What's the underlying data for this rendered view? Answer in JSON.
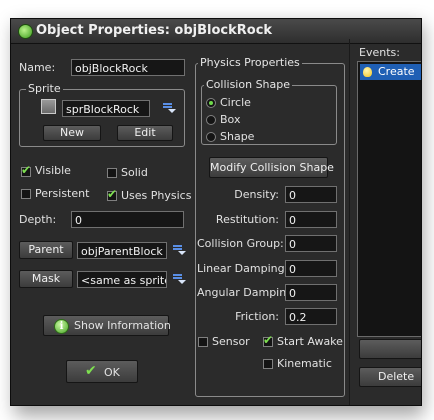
{
  "window": {
    "title": "Object Properties: objBlockRock"
  },
  "name": {
    "label": "Name:",
    "value": "objBlockRock"
  },
  "sprite": {
    "group_label": "Sprite",
    "value": "sprBlockRock",
    "new_label": "New",
    "edit_label": "Edit"
  },
  "checkboxes": {
    "visible": {
      "label": "Visible",
      "checked": true
    },
    "solid": {
      "label": "Solid",
      "checked": false
    },
    "persistent": {
      "label": "Persistent",
      "checked": false
    },
    "uses_physics": {
      "label": "Uses Physics",
      "checked": true
    }
  },
  "depth": {
    "label": "Depth:",
    "value": "0"
  },
  "parent": {
    "label": "Parent",
    "value": "objParentBlock"
  },
  "mask": {
    "label": "Mask",
    "value": "<same as sprite>"
  },
  "show_info_label": "Show Information",
  "ok_label": "OK",
  "physics": {
    "group_label": "Physics Properties",
    "collision_shape": {
      "group_label": "Collision Shape",
      "options": [
        "Circle",
        "Box",
        "Shape"
      ],
      "selected": "Circle"
    },
    "modify_label": "Modify Collision Shape",
    "fields": [
      {
        "label": "Density:",
        "value": "0"
      },
      {
        "label": "Restitution:",
        "value": "0"
      },
      {
        "label": "Collision Group:",
        "value": "0"
      },
      {
        "label": "Linear Damping:",
        "value": "0"
      },
      {
        "label": "Angular Damping:",
        "value": "0"
      },
      {
        "label": "Friction:",
        "value": "0.2"
      }
    ],
    "sensor": {
      "label": "Sensor",
      "checked": false
    },
    "start_awake": {
      "label": "Start Awake",
      "checked": true
    },
    "kinematic": {
      "label": "Kinematic",
      "checked": false
    }
  },
  "events": {
    "label": "Events:",
    "items": [
      "Create"
    ],
    "delete_label": "Delete"
  }
}
